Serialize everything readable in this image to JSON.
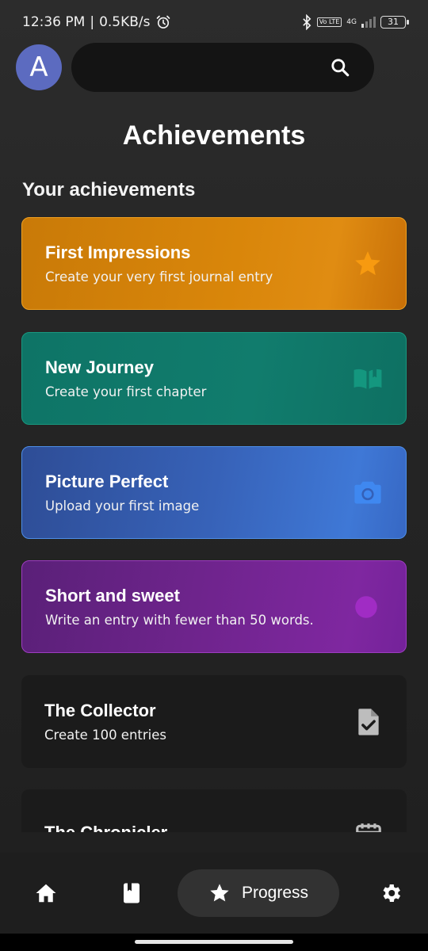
{
  "status_bar": {
    "time": "12:36 PM",
    "speed": "0.5KB/s",
    "network": "4G",
    "lte": "Vo LTE",
    "battery": "31"
  },
  "header": {
    "avatar_letter": "A",
    "search_value": ""
  },
  "page": {
    "title": "Achievements",
    "section_title": "Your achievements"
  },
  "achievements": [
    {
      "title": "First Impressions",
      "description": "Create your very first journal entry",
      "icon": "star-icon",
      "color": "#d9860a",
      "unlocked": true
    },
    {
      "title": "New Journey",
      "description": "Create your first chapter",
      "icon": "book-open-icon",
      "color": "#117c6d",
      "unlocked": true
    },
    {
      "title": "Picture Perfect",
      "description": "Upload your first image",
      "icon": "camera-icon",
      "color": "#3762b8",
      "unlocked": true
    },
    {
      "title": "Short and sweet",
      "description": "Write an entry with fewer than 50 words.",
      "icon": "dot-icon",
      "color": "#7f27a0",
      "unlocked": true
    },
    {
      "title": "The Collector",
      "description": "Create 100 entries",
      "icon": "document-check-icon",
      "color": "#1b1b1b",
      "unlocked": false
    },
    {
      "title": "The Chronicler",
      "description": "",
      "icon": "calendar-icon",
      "color": "#1b1b1b",
      "unlocked": false
    }
  ],
  "bottom_nav": {
    "progress_label": "Progress",
    "active": "progress"
  }
}
